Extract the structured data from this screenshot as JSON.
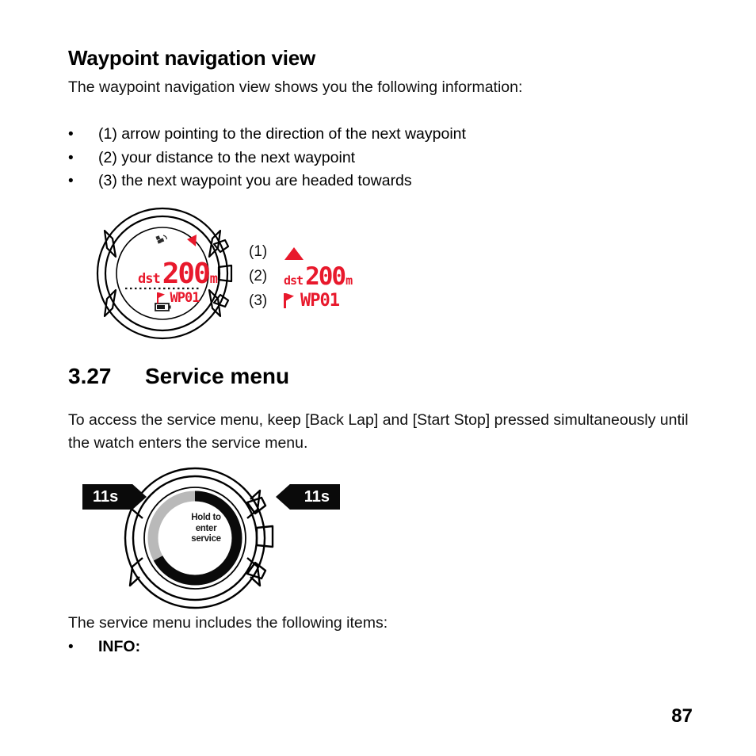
{
  "document": {
    "page_number": "87"
  },
  "waypoint_section": {
    "title": "Waypoint navigation view",
    "intro": "The waypoint navigation view shows you the following information:",
    "bullet_marker": "•",
    "bullets": [
      "(1) arrow pointing to the direction of the next waypoint",
      "(2) your distance to the next waypoint",
      "(3) the next waypoint you are headed towards"
    ],
    "legend": [
      {
        "label": "(1)",
        "kind": "arrow",
        "icon": "navigation-arrow-icon"
      },
      {
        "label": "(2)",
        "kind": "distance",
        "prefix": "dst",
        "value": "200",
        "unit": "m"
      },
      {
        "label": "(3)",
        "kind": "waypoint",
        "icon": "flag-icon",
        "value": "WP01"
      }
    ],
    "watch_display": {
      "gps_icon": "satellite-icon",
      "arrow_icon": "navigation-arrow-icon",
      "distance_prefix": "dst",
      "distance_value": "200",
      "distance_unit": "m",
      "flag_icon": "flag-icon",
      "waypoint_label": "WP01",
      "battery_icon": "battery-icon"
    }
  },
  "service_section": {
    "number": "3.27",
    "title": "Service menu",
    "paragraph": "To access the service menu, keep [Back Lap] and [Start Stop] pressed simultaneously until the watch enters the service menu.",
    "badge_left": "11s",
    "badge_right": "11s",
    "watch_display": {
      "line1": "Hold to",
      "line2": "enter",
      "line3": "service",
      "progress_ring": {
        "filled_color": "#0a0a0a",
        "remaining_color": "#b9b9b9",
        "remaining_percent": 33
      }
    },
    "items_intro": "The service menu includes the following items:",
    "bullet_marker": "•",
    "items": [
      "INFO:"
    ]
  },
  "colors": {
    "lcd_red": "#e8192c",
    "ink": "#000000",
    "ring_gray": "#b9b9b9"
  }
}
